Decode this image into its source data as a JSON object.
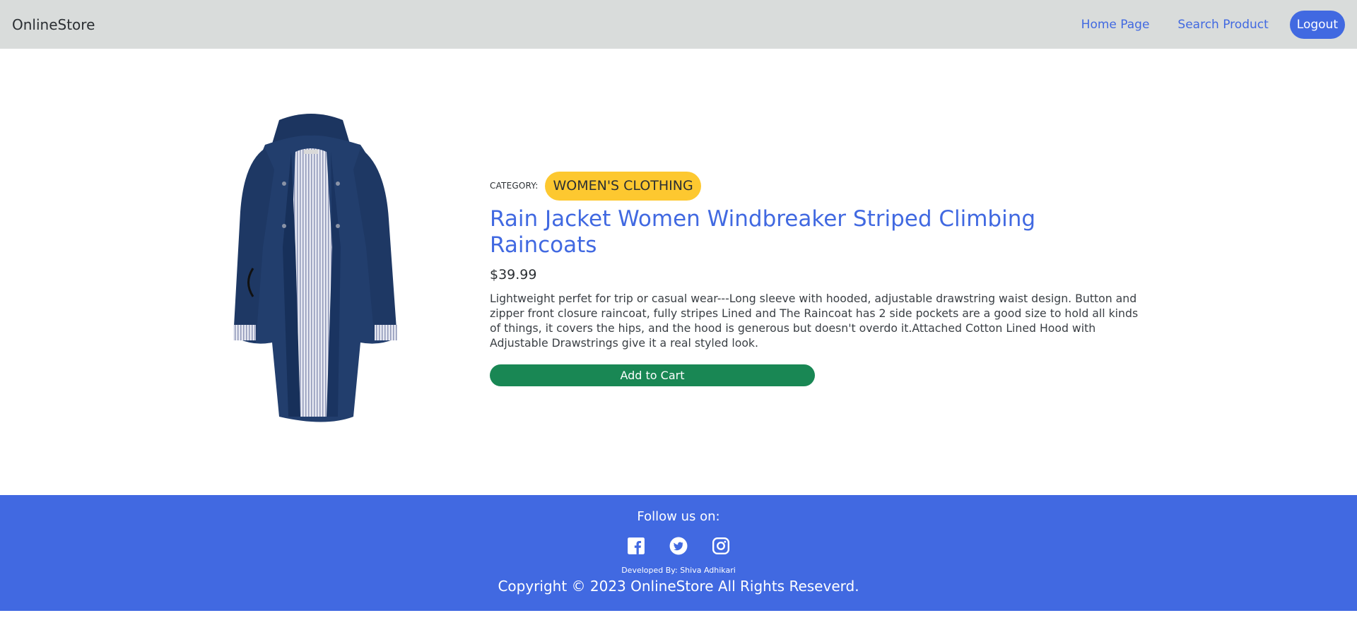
{
  "navbar": {
    "brand": "OnlineStore",
    "links": [
      "Home Page",
      "Search Product"
    ],
    "logout_label": "Logout"
  },
  "product": {
    "category_label": "CATEGORY:",
    "category": "WOMEN'S CLOTHING",
    "title": "Rain Jacket Women Windbreaker Striped Climbing Raincoats",
    "price": "$39.99",
    "description": "Lightweight perfet for trip or casual wear---Long sleeve with hooded, adjustable drawstring waist design. Button and zipper front closure raincoat, fully stripes Lined and The Raincoat has 2 side pockets are a good size to hold all kinds of things, it covers the hips, and the hood is generous but doesn't overdo it.Attached Cotton Lined Hood with Adjustable Drawstrings give it a real styled look.",
    "add_to_cart_label": "Add to Cart",
    "image_icon": "navy-rain-jacket-image"
  },
  "footer": {
    "follow_label": "Follow us on:",
    "social_icons": [
      "facebook-icon",
      "twitter-icon",
      "instagram-icon"
    ],
    "developer": "Developed By: Shiva Adhikari",
    "copyright": "Copyright © 2023 OnlineStore All Rights Reseverd."
  },
  "colors": {
    "navbar_bg": "#d9dcdb",
    "accent": "#4169e1",
    "badge": "#fdc830",
    "cart_button": "#198754",
    "footer_bg": "#4169e1"
  }
}
